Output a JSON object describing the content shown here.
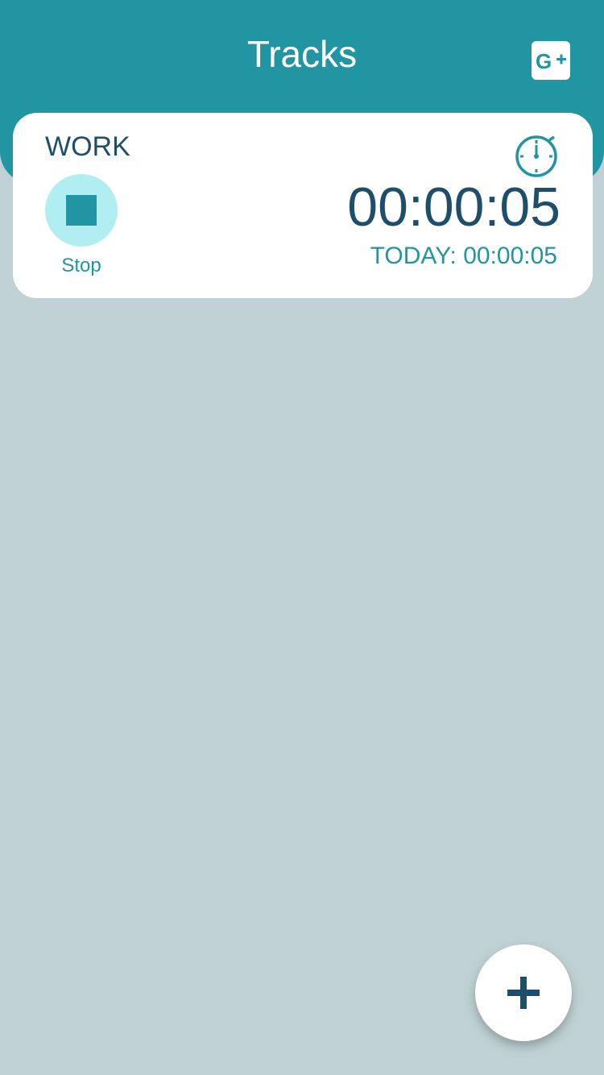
{
  "header": {
    "title": "Tracks",
    "google_plus_icon": "google-plus-icon",
    "background_color": "#2295a2"
  },
  "track": {
    "name": "WORK",
    "control_label": "Stop",
    "control_icon": "stop-icon",
    "timer_icon": "stopwatch-icon",
    "elapsed": "00:00:05",
    "today": "TODAY: 00:00:05"
  },
  "fab": {
    "icon": "plus-icon"
  },
  "colors": {
    "accent": "#2295a2",
    "dark_text": "#1f4e6b",
    "stop_bg": "#b0eef2",
    "page_bg": "#bfd1d4"
  }
}
